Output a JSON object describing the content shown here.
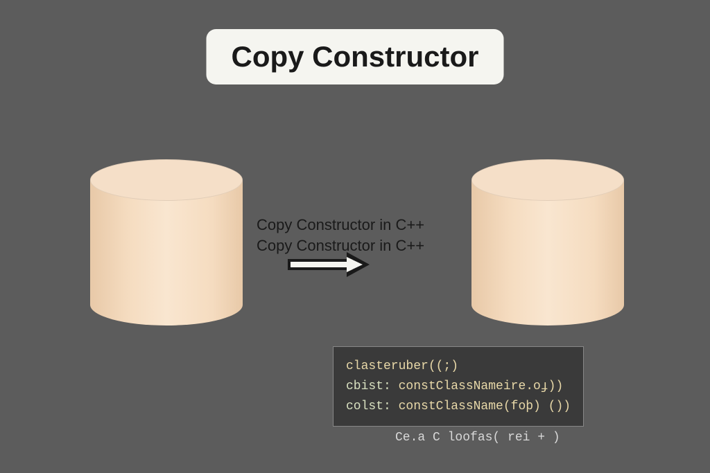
{
  "title": "Copy Constructor",
  "overlay": {
    "line1": "Copy Constructor in C++",
    "line2": "Copy Constructor in C++"
  },
  "code": {
    "line1": "clasteruber((;)",
    "line2_prefix": "cbist:",
    "line2_body": " constClassNameire.oɟ))",
    "line3_prefix": "colst:",
    "line3_body": " constClassName(foþ) ())"
  },
  "caption": "Ce.a C loofas( rei + )"
}
